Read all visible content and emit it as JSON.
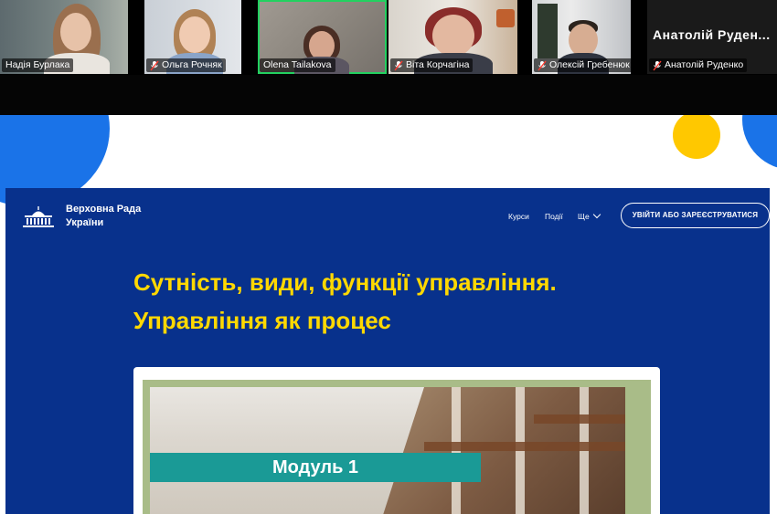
{
  "meeting": {
    "participants": [
      {
        "name": "Надія Бурлака",
        "muted": false,
        "active": false
      },
      {
        "name": "Ольга Рочняк",
        "muted": true,
        "active": false
      },
      {
        "name": "Olena Tailakova",
        "muted": false,
        "active": true
      },
      {
        "name": "Віта Корчагіна",
        "muted": true,
        "active": false
      },
      {
        "name": "Олексій Гребенюк",
        "muted": true,
        "active": false
      },
      {
        "name": "Анатолій Руденко",
        "muted": true,
        "active": false,
        "no_video_label": "Анатолій Руден..."
      }
    ],
    "active_speaker_color": "#23d160"
  },
  "site": {
    "logo_text": "Верховна Рада України",
    "nav": {
      "courses": "Курси",
      "events": "Події",
      "more": "Ще"
    },
    "login_button": "УВІЙТИ АБО ЗАРЕЄСТРУВАТИСЯ",
    "course_title_line1": "Сутність, види, функції управління.",
    "course_title_line2": "Управління як процес",
    "module_label": "Модуль 1",
    "colors": {
      "background": "#08318c",
      "title": "#ffd800",
      "module_bar": "#1a9a96",
      "accent_yellow": "#ffc800",
      "accent_blue": "#1a73e8"
    }
  }
}
